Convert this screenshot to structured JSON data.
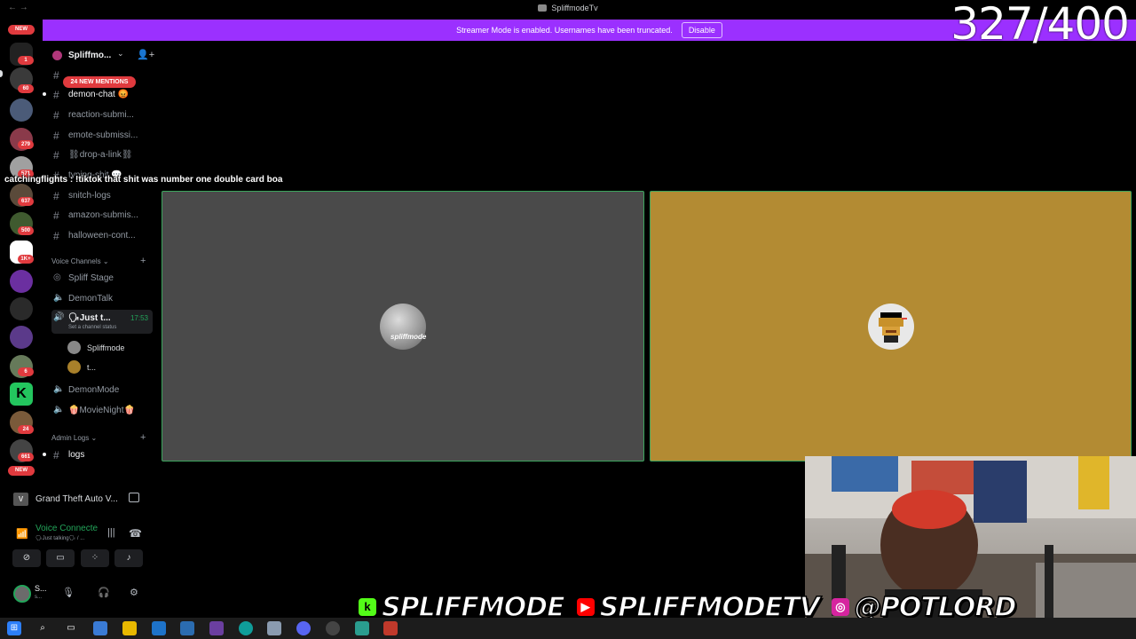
{
  "window": {
    "title": "SpliffmodeTv",
    "nav_back": "←",
    "nav_forward": "→"
  },
  "banner": {
    "text": "Streamer Mode is enabled. Usernames have been truncated.",
    "button": "Disable"
  },
  "counter": "327/400",
  "rail": {
    "new_label": "NEW",
    "badges": [
      "1",
      "60",
      "279",
      "571",
      "637",
      "500",
      "1K+",
      "6",
      "24",
      "661"
    ],
    "new_bottom": "NEW"
  },
  "server": {
    "name": "Spliffmo...",
    "chevron": "⌄",
    "invite_icon": "👤+"
  },
  "mentions_pill": "24 NEW MENTIONS",
  "text_channels": [
    {
      "name": "demon-chat 😡"
    },
    {
      "name": "reaction-submi..."
    },
    {
      "name": "emote-submissi..."
    },
    {
      "name": "⛓drop-a-link⛓"
    },
    {
      "name": "typing-shit 💬"
    },
    {
      "name": "snitch-logs"
    },
    {
      "name": "amazon-submis..."
    },
    {
      "name": "halloween-cont..."
    }
  ],
  "voice_category": "Voice Channels",
  "voice_channels": [
    {
      "name": "Spliff Stage"
    },
    {
      "name": "DemonTalk"
    },
    {
      "name": "🗣Just t...",
      "time": "17:53",
      "status": "Set a channel status"
    },
    {
      "name": "DemonMode"
    },
    {
      "name": "🍿MovieNight🍿"
    }
  ],
  "voice_users": [
    {
      "name": "Spliffmode"
    },
    {
      "name": "t..."
    }
  ],
  "admin_category": "Admin Logs",
  "admin_channels": [
    {
      "name": "logs"
    }
  ],
  "activity": {
    "game": "Grand Theft Auto V...",
    "icon_text": "V"
  },
  "voice_panel": {
    "title": "Voice Connecte",
    "subtitle": "🗣Just talking🗣 / ..."
  },
  "user_panel": {
    "name": "S...",
    "sub": "s..."
  },
  "chat": {
    "user": "catchingflights",
    "sep": " : ",
    "message": "!tiktok that shit was number one double card boa"
  },
  "socials": [
    {
      "icon": "k",
      "text": "SPLIFFMODE",
      "color": "#53fc18"
    },
    {
      "icon": "▶",
      "text": "SPLIFFMODETV",
      "color": "#ff0000"
    },
    {
      "icon": "◎",
      "text": "@POTLORD",
      "color": "#d6249f"
    }
  ],
  "colors": {
    "banner": "#9b30ff",
    "tile_1": "#4a4a4a",
    "tile_2": "#b38b33",
    "speaking_border": "#3ba55d",
    "badge": "#e03a3e",
    "voice_green": "#23a55a"
  }
}
